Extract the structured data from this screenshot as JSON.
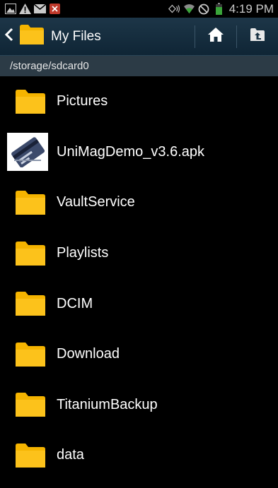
{
  "status_bar": {
    "time": "4:19 PM",
    "left_icons": [
      "gallery-icon",
      "warning-icon",
      "mail-icon",
      "close-notification-icon"
    ],
    "right_icons": [
      "nfc-icon",
      "wifi-icon",
      "no-signal-icon",
      "battery-icon"
    ],
    "accent": "#3aa53a"
  },
  "action_bar": {
    "title": "My Files",
    "icons": [
      "back-chevron-icon",
      "folder-icon",
      "home-icon",
      "up-folder-icon"
    ]
  },
  "path": "/storage/sdcard0",
  "files": [
    {
      "name": "Pictures",
      "type": "folder",
      "icon": "folder-icon"
    },
    {
      "name": "UniMagDemo_v3.6.apk",
      "type": "apk",
      "icon": "credit-card-app-icon"
    },
    {
      "name": "VaultService",
      "type": "folder",
      "icon": "folder-icon"
    },
    {
      "name": "Playlists",
      "type": "folder",
      "icon": "folder-icon"
    },
    {
      "name": "DCIM",
      "type": "folder",
      "icon": "folder-icon"
    },
    {
      "name": "Download",
      "type": "folder",
      "icon": "folder-icon"
    },
    {
      "name": "TitaniumBackup",
      "type": "folder",
      "icon": "folder-icon"
    },
    {
      "name": "data",
      "type": "folder",
      "icon": "folder-icon"
    }
  ],
  "colors": {
    "folder": "#f5b400",
    "action_bar": "#16303f",
    "path_bar": "#2c3b46"
  }
}
